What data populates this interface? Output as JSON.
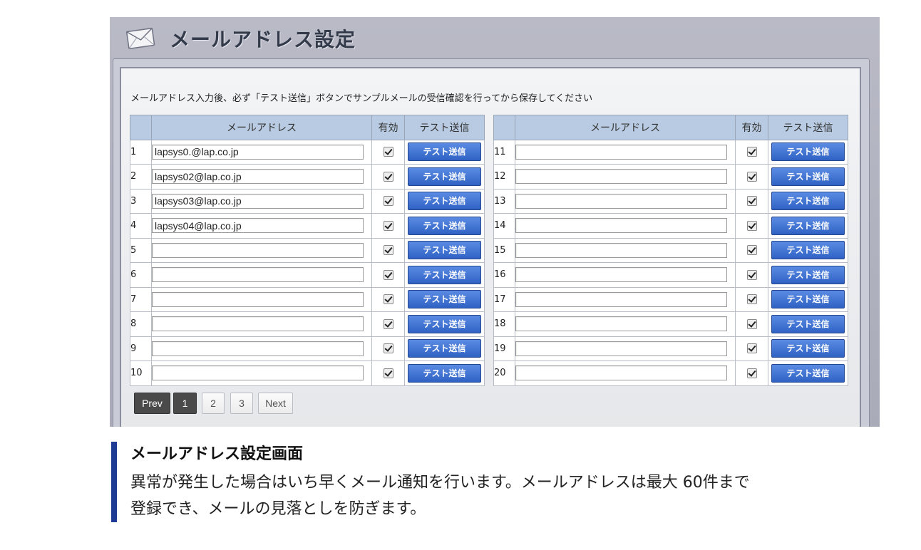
{
  "window": {
    "title": "メールアドレス設定",
    "instruction": "メールアドレス入力後、必ず「テスト送信」ボタンでサンプルメールの受信確認を行ってから保存してください"
  },
  "table": {
    "headers": {
      "address": "メールアドレス",
      "enabled": "有効",
      "test": "テスト送信"
    },
    "button_label": "テスト送信",
    "left_rows": [
      {
        "num": "1",
        "email": "lapsys0.@lap.co.jp",
        "enabled": true
      },
      {
        "num": "2",
        "email": "lapsys02@lap.co.jp",
        "enabled": true
      },
      {
        "num": "3",
        "email": "lapsys03@lap.co.jp",
        "enabled": true
      },
      {
        "num": "4",
        "email": "lapsys04@lap.co.jp",
        "enabled": true
      },
      {
        "num": "5",
        "email": "",
        "enabled": true
      },
      {
        "num": "6",
        "email": "",
        "enabled": true
      },
      {
        "num": "7",
        "email": "",
        "enabled": true
      },
      {
        "num": "8",
        "email": "",
        "enabled": true
      },
      {
        "num": "9",
        "email": "",
        "enabled": true
      },
      {
        "num": "10",
        "email": "",
        "enabled": true
      }
    ],
    "right_rows": [
      {
        "num": "11",
        "email": "",
        "enabled": true
      },
      {
        "num": "12",
        "email": "",
        "enabled": true
      },
      {
        "num": "13",
        "email": "",
        "enabled": true
      },
      {
        "num": "14",
        "email": "",
        "enabled": true
      },
      {
        "num": "15",
        "email": "",
        "enabled": true
      },
      {
        "num": "16",
        "email": "",
        "enabled": true
      },
      {
        "num": "17",
        "email": "",
        "enabled": true
      },
      {
        "num": "18",
        "email": "",
        "enabled": true
      },
      {
        "num": "19",
        "email": "",
        "enabled": true
      },
      {
        "num": "20",
        "email": "",
        "enabled": true
      }
    ]
  },
  "pagination": {
    "prev": "Prev",
    "pages": [
      "1",
      "2",
      "3"
    ],
    "current": "1",
    "next": "Next"
  },
  "caption": {
    "title": "メールアドレス設定画面",
    "line1": "異常が発生した場合はいち早くメール通知を行います。メールアドレスは最大 60件まで",
    "line2": "登録でき、メールの見落としを防ぎます。"
  },
  "colors": {
    "button": "#3b6fd1",
    "header": "#b9cbe2",
    "caption_accent": "#1f3a93",
    "pager_active": "#4a4a4a"
  },
  "icons": {
    "title": "envelope-icon"
  }
}
